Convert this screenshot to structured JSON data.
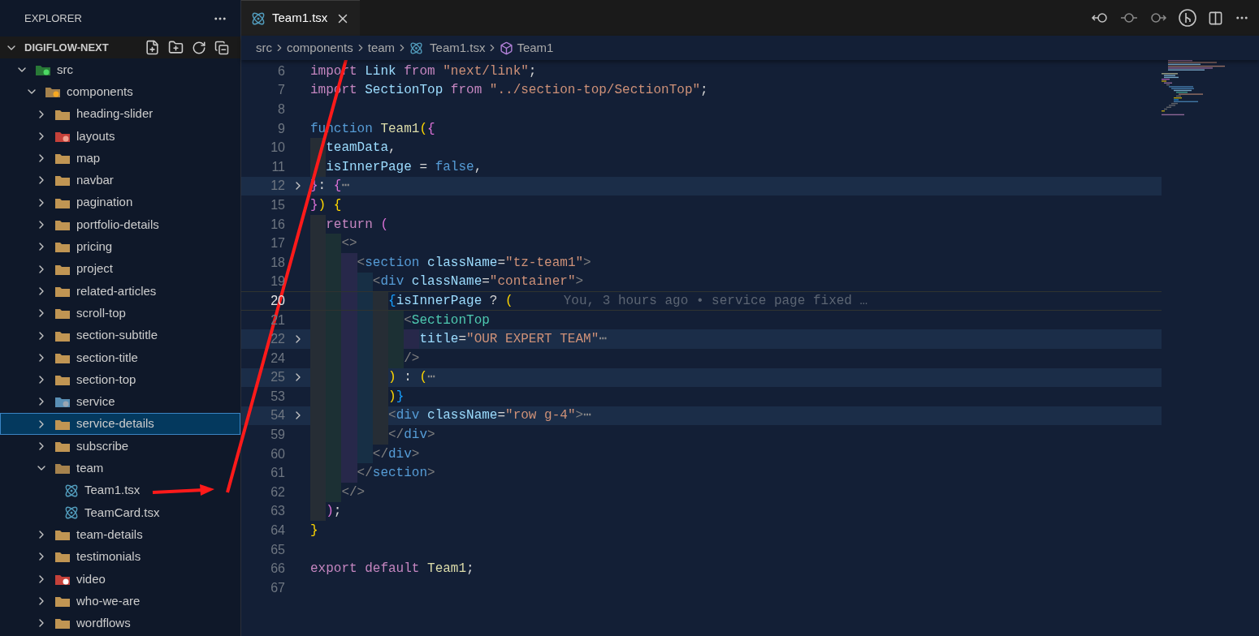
{
  "sidebar": {
    "title": "EXPLORER",
    "root": {
      "label": "DIGIFLOW-NEXT",
      "expanded": true,
      "children": [
        {
          "label": "src",
          "kind": "src-folder",
          "expanded": true,
          "selected": false,
          "children": [
            {
              "label": "components",
              "kind": "components-folder",
              "expanded": true,
              "selected": false,
              "children": [
                {
                  "label": "heading-slider",
                  "kind": "folder",
                  "expanded": false,
                  "selected": false
                },
                {
                  "label": "layouts",
                  "kind": "layouts-folder",
                  "expanded": false,
                  "selected": false
                },
                {
                  "label": "map",
                  "kind": "folder",
                  "expanded": false,
                  "selected": false
                },
                {
                  "label": "navbar",
                  "kind": "folder",
                  "expanded": false,
                  "selected": false
                },
                {
                  "label": "pagination",
                  "kind": "folder",
                  "expanded": false,
                  "selected": false
                },
                {
                  "label": "portfolio-details",
                  "kind": "folder",
                  "expanded": false,
                  "selected": false
                },
                {
                  "label": "pricing",
                  "kind": "folder",
                  "expanded": false,
                  "selected": false
                },
                {
                  "label": "project",
                  "kind": "folder",
                  "expanded": false,
                  "selected": false
                },
                {
                  "label": "related-articles",
                  "kind": "folder",
                  "expanded": false,
                  "selected": false
                },
                {
                  "label": "scroll-top",
                  "kind": "folder",
                  "expanded": false,
                  "selected": false
                },
                {
                  "label": "section-subtitle",
                  "kind": "folder",
                  "expanded": false,
                  "selected": false
                },
                {
                  "label": "section-title",
                  "kind": "folder",
                  "expanded": false,
                  "selected": false
                },
                {
                  "label": "section-top",
                  "kind": "folder",
                  "expanded": false,
                  "selected": false
                },
                {
                  "label": "service",
                  "kind": "service-folder",
                  "expanded": false,
                  "selected": false
                },
                {
                  "label": "service-details",
                  "kind": "folder",
                  "expanded": false,
                  "selected": true
                },
                {
                  "label": "subscribe",
                  "kind": "folder",
                  "expanded": false,
                  "selected": false
                },
                {
                  "label": "team",
                  "kind": "folder",
                  "expanded": true,
                  "selected": false,
                  "children": [
                    {
                      "label": "Team1.tsx",
                      "kind": "react-file",
                      "selected": false
                    },
                    {
                      "label": "TeamCard.tsx",
                      "kind": "react-file",
                      "selected": false
                    }
                  ]
                },
                {
                  "label": "team-details",
                  "kind": "folder",
                  "expanded": false,
                  "selected": false
                },
                {
                  "label": "testimonials",
                  "kind": "folder",
                  "expanded": false,
                  "selected": false
                },
                {
                  "label": "video",
                  "kind": "video-folder",
                  "expanded": false,
                  "selected": false
                },
                {
                  "label": "who-we-are",
                  "kind": "folder",
                  "expanded": false,
                  "selected": false
                },
                {
                  "label": "wordflows",
                  "kind": "folder",
                  "expanded": false,
                  "selected": false
                }
              ]
            }
          ]
        }
      ]
    }
  },
  "tabs": [
    {
      "label": "Team1.tsx",
      "selected": true
    }
  ],
  "breadcrumbs": [
    {
      "label": "src",
      "kind": "plain"
    },
    {
      "label": "components",
      "kind": "plain"
    },
    {
      "label": "team",
      "kind": "plain"
    },
    {
      "label": "Team1.tsx",
      "kind": "file"
    },
    {
      "label": "Team1",
      "kind": "symbol"
    }
  ],
  "editor": {
    "lines": [
      {
        "number": "6",
        "folded": false,
        "current": false,
        "tokens": [
          {
            "text": "import",
            "kind": "keyword"
          },
          {
            "text": " Link ",
            "kind": "var"
          },
          {
            "text": "from",
            "kind": "keyword"
          },
          {
            "text": " \"next/link\"",
            "kind": "string"
          },
          {
            "text": ";",
            "kind": "plain"
          }
        ]
      },
      {
        "number": "7",
        "folded": false,
        "current": false,
        "tokens": [
          {
            "text": "import",
            "kind": "keyword"
          },
          {
            "text": " SectionTop ",
            "kind": "var"
          },
          {
            "text": "from",
            "kind": "keyword"
          },
          {
            "text": " \"../section-top/SectionTop\"",
            "kind": "string"
          },
          {
            "text": ";",
            "kind": "plain"
          }
        ]
      },
      {
        "number": "8",
        "folded": false,
        "current": false
      },
      {
        "number": "9",
        "folded": false,
        "current": false,
        "tokens": [
          {
            "text": "function",
            "kind": "storage"
          },
          {
            "text": " Team1",
            "kind": "func"
          },
          {
            "text": "(",
            "kind": "b1"
          },
          {
            "text": "{",
            "kind": "b2"
          }
        ]
      },
      {
        "number": "10",
        "folded": false,
        "current": false,
        "tokens": [
          {
            "text": "  teamData",
            "kind": "var"
          },
          {
            "text": ",",
            "kind": "plain"
          }
        ]
      },
      {
        "number": "11",
        "folded": false,
        "current": false,
        "tokens": [
          {
            "text": "  isInnerPage",
            "kind": "var"
          },
          {
            "text": " = ",
            "kind": "plain"
          },
          {
            "text": "false",
            "kind": "constant"
          },
          {
            "text": ",",
            "kind": "plain"
          }
        ]
      },
      {
        "number": "12",
        "folded": true,
        "current": false,
        "tokens": [
          {
            "text": "}",
            "kind": "b2"
          },
          {
            "text": ": ",
            "kind": "plain"
          },
          {
            "text": "{",
            "kind": "b2"
          },
          {
            "text": "⋯",
            "kind": "fold"
          }
        ]
      },
      {
        "number": "15",
        "folded": false,
        "current": false,
        "tokens": [
          {
            "text": "}",
            "kind": "b2"
          },
          {
            "text": ")",
            "kind": "b1"
          },
          {
            "text": " {",
            "kind": "b1"
          }
        ]
      },
      {
        "number": "16",
        "folded": false,
        "current": false,
        "tokens": [
          {
            "text": "  return",
            "kind": "keyword"
          },
          {
            "text": " (",
            "kind": "b2"
          }
        ]
      },
      {
        "number": "17",
        "folded": false,
        "current": false,
        "tokens": [
          {
            "text": "    <>",
            "kind": "punct"
          }
        ]
      },
      {
        "number": "18",
        "folded": false,
        "current": false,
        "tokens": [
          {
            "text": "      <",
            "kind": "punct"
          },
          {
            "text": "section",
            "kind": "tag"
          },
          {
            "text": " className",
            "kind": "var"
          },
          {
            "text": "=",
            "kind": "plain"
          },
          {
            "text": "\"tz-team1\"",
            "kind": "string"
          },
          {
            "text": ">",
            "kind": "punct"
          }
        ]
      },
      {
        "number": "19",
        "folded": false,
        "current": false,
        "tokens": [
          {
            "text": "        <",
            "kind": "punct"
          },
          {
            "text": "div",
            "kind": "tag"
          },
          {
            "text": " className",
            "kind": "var"
          },
          {
            "text": "=",
            "kind": "plain"
          },
          {
            "text": "\"container\"",
            "kind": "string"
          },
          {
            "text": ">",
            "kind": "punct"
          }
        ]
      },
      {
        "number": "20",
        "folded": false,
        "current": true,
        "blame": "You, 3 hours ago • service page fixed …",
        "tokens": [
          {
            "text": "          {",
            "kind": "b3"
          },
          {
            "text": "isInnerPage",
            "kind": "var"
          },
          {
            "text": " ? ",
            "kind": "plain"
          },
          {
            "text": "(",
            "kind": "b1"
          }
        ]
      },
      {
        "number": "21",
        "folded": false,
        "current": false,
        "tokens": [
          {
            "text": "            <",
            "kind": "punct"
          },
          {
            "text": "SectionTop",
            "kind": "component"
          }
        ]
      },
      {
        "number": "22",
        "folded": true,
        "current": false,
        "tokens": [
          {
            "text": "              title",
            "kind": "var"
          },
          {
            "text": "=",
            "kind": "plain"
          },
          {
            "text": "\"OUR EXPERT TEAM\"",
            "kind": "string"
          },
          {
            "text": "⋯",
            "kind": "fold"
          }
        ]
      },
      {
        "number": "24",
        "folded": false,
        "current": false,
        "tokens": [
          {
            "text": "            />",
            "kind": "punct"
          }
        ]
      },
      {
        "number": "25",
        "folded": true,
        "current": false,
        "tokens": [
          {
            "text": "          )",
            "kind": "b1"
          },
          {
            "text": " : ",
            "kind": "plain"
          },
          {
            "text": "(",
            "kind": "b1"
          },
          {
            "text": "⋯",
            "kind": "fold"
          }
        ]
      },
      {
        "number": "53",
        "folded": false,
        "current": false,
        "tokens": [
          {
            "text": "          )",
            "kind": "b1"
          },
          {
            "text": "}",
            "kind": "b3"
          }
        ]
      },
      {
        "number": "54",
        "folded": true,
        "current": false,
        "tokens": [
          {
            "text": "          <",
            "kind": "punct"
          },
          {
            "text": "div",
            "kind": "tag"
          },
          {
            "text": " className",
            "kind": "var"
          },
          {
            "text": "=",
            "kind": "plain"
          },
          {
            "text": "\"row g-4\"",
            "kind": "string"
          },
          {
            "text": ">",
            "kind": "punct"
          },
          {
            "text": "⋯",
            "kind": "fold"
          }
        ]
      },
      {
        "number": "59",
        "folded": false,
        "current": false,
        "tokens": [
          {
            "text": "          </",
            "kind": "punct"
          },
          {
            "text": "div",
            "kind": "tag"
          },
          {
            "text": ">",
            "kind": "punct"
          }
        ]
      },
      {
        "number": "60",
        "folded": false,
        "current": false,
        "tokens": [
          {
            "text": "        </",
            "kind": "punct"
          },
          {
            "text": "div",
            "kind": "tag"
          },
          {
            "text": ">",
            "kind": "punct"
          }
        ]
      },
      {
        "number": "61",
        "folded": false,
        "current": false,
        "tokens": [
          {
            "text": "      </",
            "kind": "punct"
          },
          {
            "text": "section",
            "kind": "tag"
          },
          {
            "text": ">",
            "kind": "punct"
          }
        ]
      },
      {
        "number": "62",
        "folded": false,
        "current": false,
        "tokens": [
          {
            "text": "    </>",
            "kind": "punct"
          }
        ]
      },
      {
        "number": "63",
        "folded": false,
        "current": false,
        "tokens": [
          {
            "text": "  )",
            "kind": "b2"
          },
          {
            "text": ";",
            "kind": "plain"
          }
        ]
      },
      {
        "number": "64",
        "folded": false,
        "current": false,
        "tokens": [
          {
            "text": "}",
            "kind": "b1"
          }
        ]
      },
      {
        "number": "65",
        "folded": false,
        "current": false
      },
      {
        "number": "66",
        "folded": false,
        "current": false,
        "tokens": [
          {
            "text": "export",
            "kind": "keyword"
          },
          {
            "text": " default",
            "kind": "keyword"
          },
          {
            "text": " Team1",
            "kind": "func"
          },
          {
            "text": ";",
            "kind": "plain"
          }
        ]
      },
      {
        "number": "67",
        "folded": false,
        "current": false
      }
    ]
  }
}
